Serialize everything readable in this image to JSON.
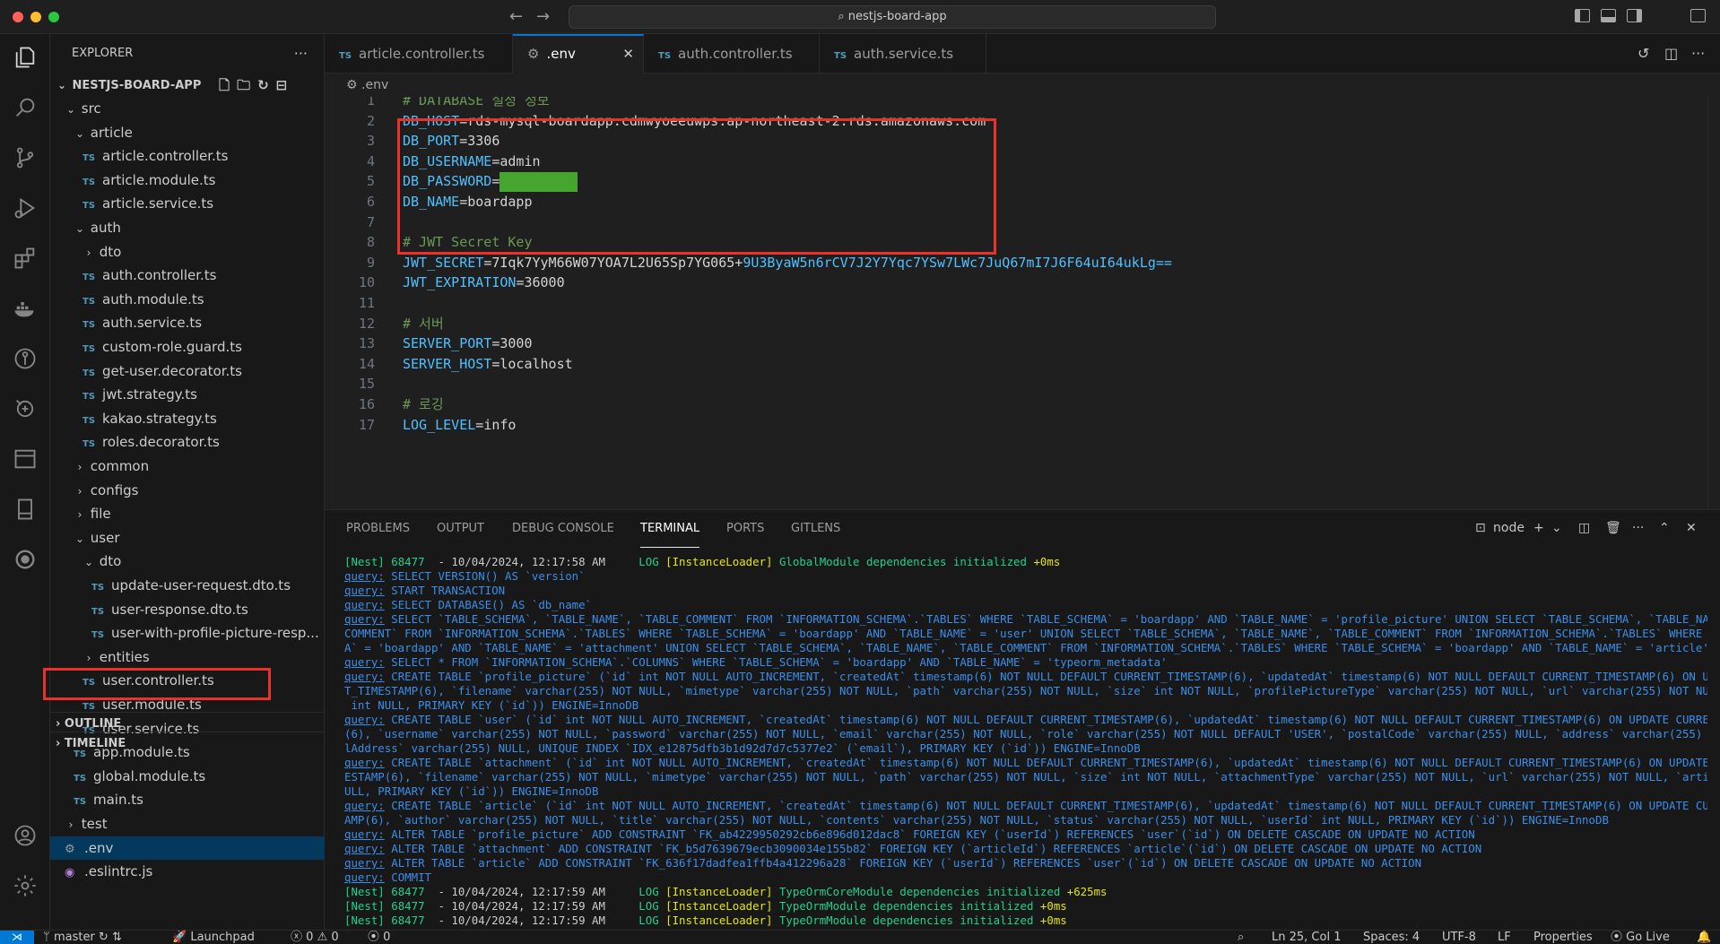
{
  "window": {
    "title": "nestjs-board-app",
    "traffic_colors": [
      "#ff5f57",
      "#febc2e",
      "#28c840"
    ]
  },
  "sidebar": {
    "title": "EXPLORER",
    "root": "NESTJS-BOARD-APP",
    "tree": [
      {
        "label": "src",
        "kind": "folder-open",
        "indent": 1
      },
      {
        "label": "article",
        "kind": "folder-open",
        "indent": 2
      },
      {
        "label": "article.controller.ts",
        "kind": "ts",
        "indent": 3
      },
      {
        "label": "article.module.ts",
        "kind": "ts",
        "indent": 3
      },
      {
        "label": "article.service.ts",
        "kind": "ts",
        "indent": 3
      },
      {
        "label": "auth",
        "kind": "folder-open",
        "indent": 2
      },
      {
        "label": "dto",
        "kind": "folder",
        "indent": 3
      },
      {
        "label": "auth.controller.ts",
        "kind": "ts",
        "indent": 3
      },
      {
        "label": "auth.module.ts",
        "kind": "ts",
        "indent": 3
      },
      {
        "label": "auth.service.ts",
        "kind": "ts",
        "indent": 3
      },
      {
        "label": "custom-role.guard.ts",
        "kind": "ts",
        "indent": 3
      },
      {
        "label": "get-user.decorator.ts",
        "kind": "ts",
        "indent": 3
      },
      {
        "label": "jwt.strategy.ts",
        "kind": "ts",
        "indent": 3
      },
      {
        "label": "kakao.strategy.ts",
        "kind": "ts",
        "indent": 3
      },
      {
        "label": "roles.decorator.ts",
        "kind": "ts",
        "indent": 3
      },
      {
        "label": "common",
        "kind": "folder",
        "indent": 2
      },
      {
        "label": "configs",
        "kind": "folder",
        "indent": 2
      },
      {
        "label": "file",
        "kind": "folder",
        "indent": 2
      },
      {
        "label": "user",
        "kind": "folder-open",
        "indent": 2
      },
      {
        "label": "dto",
        "kind": "folder-open",
        "indent": 3
      },
      {
        "label": "update-user-request.dto.ts",
        "kind": "ts",
        "indent": 4
      },
      {
        "label": "user-response.dto.ts",
        "kind": "ts",
        "indent": 4
      },
      {
        "label": "user-with-profile-picture-resp...",
        "kind": "ts",
        "indent": 4
      },
      {
        "label": "entities",
        "kind": "folder",
        "indent": 3
      },
      {
        "label": "user.controller.ts",
        "kind": "ts",
        "indent": 3
      },
      {
        "label": "user.module.ts",
        "kind": "ts",
        "indent": 3
      },
      {
        "label": "user.service.ts",
        "kind": "ts",
        "indent": 3
      },
      {
        "label": "app.module.ts",
        "kind": "ts",
        "indent": 2
      },
      {
        "label": "global.module.ts",
        "kind": "ts",
        "indent": 2
      },
      {
        "label": "main.ts",
        "kind": "ts",
        "indent": 2
      },
      {
        "label": "test",
        "kind": "folder",
        "indent": 1
      },
      {
        "label": ".env",
        "kind": "env",
        "indent": 1,
        "selected": true
      },
      {
        "label": ".eslintrc.js",
        "kind": "eslint",
        "indent": 1
      }
    ],
    "sections": [
      "OUTLINE",
      "TIMELINE"
    ]
  },
  "tabs": [
    {
      "label": "article.controller.ts",
      "icon": "TS",
      "active": false
    },
    {
      "label": ".env",
      "icon": "gear",
      "active": true
    },
    {
      "label": "auth.controller.ts",
      "icon": "TS",
      "active": false
    },
    {
      "label": "auth.service.ts",
      "icon": "TS",
      "active": false
    }
  ],
  "breadcrumb": ".env",
  "editor": {
    "lines": [
      {
        "n": "1",
        "type": "comment",
        "text": "# DATABASE 설정 정보"
      },
      {
        "n": "2",
        "type": "kv",
        "key": "DB_HOST",
        "value": "rds-mysql-boardapp.cdmwyoeeuwps.ap-northeast-2.rds.amazonaws.com"
      },
      {
        "n": "3",
        "type": "kv",
        "key": "DB_PORT",
        "value": "3306"
      },
      {
        "n": "4",
        "type": "kv",
        "key": "DB_USERNAME",
        "value": "admin"
      },
      {
        "n": "5",
        "type": "kv-masked",
        "key": "DB_PASSWORD",
        "value": ""
      },
      {
        "n": "6",
        "type": "kv",
        "key": "DB_NAME",
        "value": "boardapp"
      },
      {
        "n": "7",
        "type": "blank"
      },
      {
        "n": "8",
        "type": "comment",
        "text": "# JWT Secret Key"
      },
      {
        "n": "9",
        "type": "kv-split",
        "key": "JWT_SECRET",
        "value": "7Iqk7YyM66W07YOA7L2U65Sp7YG065+",
        "value2": "9U3ByaW5n6rCV7J2Y7Yqc7YSw7LWc7JuQ67mI7J6F64uI64ukLg=="
      },
      {
        "n": "10",
        "type": "kv",
        "key": "JWT_EXPIRATION",
        "value": "36000"
      },
      {
        "n": "11",
        "type": "blank"
      },
      {
        "n": "12",
        "type": "comment",
        "text": "# 서버"
      },
      {
        "n": "13",
        "type": "kv",
        "key": "SERVER_PORT",
        "value": "3000"
      },
      {
        "n": "14",
        "type": "kv",
        "key": "SERVER_HOST",
        "value": "localhost"
      },
      {
        "n": "15",
        "type": "blank"
      },
      {
        "n": "16",
        "type": "comment",
        "text": "# 로깅"
      },
      {
        "n": "17",
        "type": "kv",
        "key": "LOG_LEVEL",
        "value": "info"
      }
    ]
  },
  "panel": {
    "tabs": [
      "PROBLEMS",
      "OUTPUT",
      "DEBUG CONSOLE",
      "TERMINAL",
      "PORTS",
      "GITLENS"
    ],
    "active_tab": "TERMINAL",
    "terminal_name": "node",
    "terminal": [
      {
        "t": "log",
        "pid": "68477",
        "time": "10/04/2024, 12:17:58 AM",
        "msg": "GlobalModule dependencies initialized",
        "ms": "+0ms"
      },
      {
        "t": "q",
        "text": "SELECT VERSION() AS `version`"
      },
      {
        "t": "q",
        "text": "START TRANSACTION"
      },
      {
        "t": "q",
        "text": "SELECT DATABASE() AS `db_name`"
      },
      {
        "t": "q",
        "text": "SELECT `TABLE_SCHEMA`, `TABLE_NAME`, `TABLE_COMMENT` FROM `INFORMATION_SCHEMA`.`TABLES` WHERE `TABLE_SCHEMA` = 'boardapp' AND `TABLE_NAME` = 'profile_picture' UNION SELECT `TABLE_SCHEMA`, `TABLE_NAME`, `TABLE_"
      },
      {
        "t": "c",
        "text": "COMMENT` FROM `INFORMATION_SCHEMA`.`TABLES` WHERE `TABLE_SCHEMA` = 'boardapp' AND `TABLE_NAME` = 'user' UNION SELECT `TABLE_SCHEMA`, `TABLE_NAME`, `TABLE_COMMENT` FROM `INFORMATION_SCHEMA`.`TABLES` WHERE `TABLE_SCHEM"
      },
      {
        "t": "c",
        "text": "A` = 'boardapp' AND `TABLE_NAME` = 'attachment' UNION SELECT `TABLE_SCHEMA`, `TABLE_NAME`, `TABLE_COMMENT` FROM `INFORMATION_SCHEMA`.`TABLES` WHERE `TABLE_SCHEMA` = 'boardapp' AND `TABLE_NAME` = 'article'"
      },
      {
        "t": "q",
        "text": "SELECT * FROM `INFORMATION_SCHEMA`.`COLUMNS` WHERE `TABLE_SCHEMA` = 'boardapp' AND `TABLE_NAME` = 'typeorm_metadata'"
      },
      {
        "t": "q",
        "text": "CREATE TABLE `profile_picture` (`id` int NOT NULL AUTO_INCREMENT, `createdAt` timestamp(6) NOT NULL DEFAULT CURRENT_TIMESTAMP(6), `updatedAt` timestamp(6) NOT NULL DEFAULT CURRENT_TIMESTAMP(6) ON UPDATE CURREN"
      },
      {
        "t": "c",
        "text": "T_TIMESTAMP(6), `filename` varchar(255) NOT NULL, `mimetype` varchar(255) NOT NULL, `path` varchar(255) NOT NULL, `size` int NOT NULL, `profilePictureType` varchar(255) NOT NULL, `url` varchar(255) NOT NULL, `userId`"
      },
      {
        "t": "c",
        "text": " int NULL, PRIMARY KEY (`id`)) ENGINE=InnoDB"
      },
      {
        "t": "q",
        "text": "CREATE TABLE `user` (`id` int NOT NULL AUTO_INCREMENT, `createdAt` timestamp(6) NOT NULL DEFAULT CURRENT_TIMESTAMP(6), `updatedAt` timestamp(6) NOT NULL DEFAULT CURRENT_TIMESTAMP(6) ON UPDATE CURRENT_TIMESTAMP"
      },
      {
        "t": "c",
        "text": "(6), `username` varchar(255) NOT NULL, `password` varchar(255) NOT NULL, `email` varchar(255) NOT NULL, `role` varchar(255) NOT NULL DEFAULT 'USER', `postalCode` varchar(255) NULL, `address` varchar(255) NULL, `detai"
      },
      {
        "t": "c",
        "text": "lAddress` varchar(255) NULL, UNIQUE INDEX `IDX_e12875dfb3b1d92d7d7c5377e2` (`email`), PRIMARY KEY (`id`)) ENGINE=InnoDB"
      },
      {
        "t": "q",
        "text": "CREATE TABLE `attachment` (`id` int NOT NULL AUTO_INCREMENT, `createdAt` timestamp(6) NOT NULL DEFAULT CURRENT_TIMESTAMP(6), `updatedAt` timestamp(6) NOT NULL DEFAULT CURRENT_TIMESTAMP(6) ON UPDATE CURRENT_TIM"
      },
      {
        "t": "c",
        "text": "ESTAMP(6), `filename` varchar(255) NOT NULL, `mimetype` varchar(255) NOT NULL, `path` varchar(255) NOT NULL, `size` int NOT NULL, `attachmentType` varchar(255) NOT NULL, `url` varchar(255) NOT NULL, `articleId` int N"
      },
      {
        "t": "c",
        "text": "ULL, PRIMARY KEY (`id`)) ENGINE=InnoDB"
      },
      {
        "t": "q",
        "text": "CREATE TABLE `article` (`id` int NOT NULL AUTO_INCREMENT, `createdAt` timestamp(6) NOT NULL DEFAULT CURRENT_TIMESTAMP(6), `updatedAt` timestamp(6) NOT NULL DEFAULT CURRENT_TIMESTAMP(6) ON UPDATE CURRENT_TIMEST"
      },
      {
        "t": "c",
        "text": "AMP(6), `author` varchar(255) NOT NULL, `title` varchar(255) NOT NULL, `contents` varchar(255) NOT NULL, `status` varchar(255) NOT NULL, `userId` int NULL, PRIMARY KEY (`id`)) ENGINE=InnoDB"
      },
      {
        "t": "q",
        "text": "ALTER TABLE `profile_picture` ADD CONSTRAINT `FK_ab4229950292cb6e896d012dac8` FOREIGN KEY (`userId`) REFERENCES `user`(`id`) ON DELETE CASCADE ON UPDATE NO ACTION"
      },
      {
        "t": "q",
        "text": "ALTER TABLE `attachment` ADD CONSTRAINT `FK_b5d7639679ecb3090034e155b82` FOREIGN KEY (`articleId`) REFERENCES `article`(`id`) ON DELETE CASCADE ON UPDATE NO ACTION"
      },
      {
        "t": "q",
        "text": "ALTER TABLE `article` ADD CONSTRAINT `FK_636f17dadfea1ffb4a412296a28` FOREIGN KEY (`userId`) REFERENCES `user`(`id`) ON DELETE CASCADE ON UPDATE NO ACTION"
      },
      {
        "t": "q",
        "text": "COMMIT"
      },
      {
        "t": "log",
        "pid": "68477",
        "time": "10/04/2024, 12:17:59 AM",
        "msg": "TypeOrmCoreModule dependencies initialized",
        "ms": "+625ms"
      },
      {
        "t": "log",
        "pid": "68477",
        "time": "10/04/2024, 12:17:59 AM",
        "msg": "TypeOrmModule dependencies initialized",
        "ms": "+0ms"
      },
      {
        "t": "log",
        "pid": "68477",
        "time": "10/04/2024, 12:17:59 AM",
        "msg": "TypeOrmModule dependencies initialized",
        "ms": "+0ms"
      }
    ]
  },
  "statusbar": {
    "branch": "master",
    "launchpad": "Launchpad",
    "errors": "0",
    "warnings": "0",
    "ports": "0",
    "position": "Ln 25, Col 1",
    "spaces": "Spaces: 4",
    "encoding": "UTF-8",
    "eol": "LF",
    "language": "Properties",
    "golive": "Go Live"
  },
  "labels": {
    "nest_tag": "[Nest]",
    "log_tag": "LOG",
    "loader_tag": "[InstanceLoader]",
    "query_tag": "query:"
  }
}
